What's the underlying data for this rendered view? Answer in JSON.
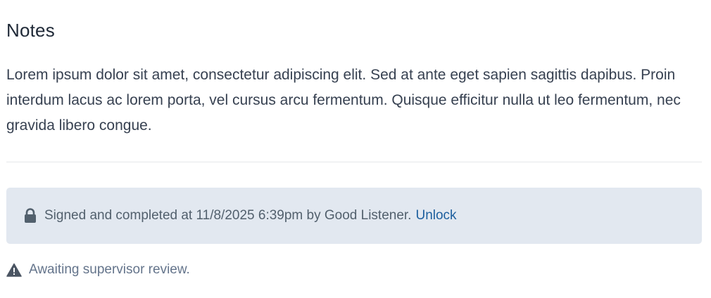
{
  "notes": {
    "title": "Notes",
    "body": "Lorem ipsum dolor sit amet, consectetur adipiscing elit. Sed at ante eget sapien sagittis dapibus. Proin interdum lacus ac lorem porta, vel cursus arcu fermentum. Quisque efficitur nulla ut leo fermentum, nec gravida libero congue."
  },
  "signature": {
    "icon": "lock-icon",
    "text": "Signed and completed at 11/8/2025 6:39pm by Good Listener.",
    "unlock_label": "Unlock",
    "banner_color": "#e2e8f0",
    "link_color": "#1d5f9e"
  },
  "review": {
    "icon": "warning-icon",
    "text": "Awaiting supervisor review."
  }
}
